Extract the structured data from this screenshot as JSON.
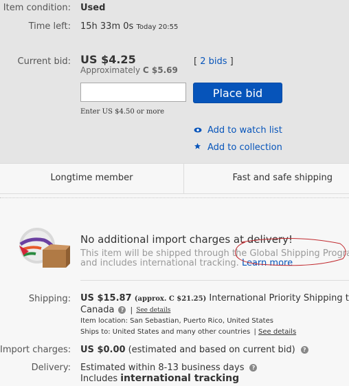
{
  "item": {
    "condition_label": "Item condition:",
    "condition_value": "Used",
    "time_left_label": "Time left:",
    "time_left_value": "15h 33m 0s",
    "time_left_end": "Today 20:55"
  },
  "bid": {
    "label": "Current bid:",
    "amount": "US $4.25",
    "approx_prefix": "Approximately",
    "approx_value": "C $5.69",
    "bids_open": "[",
    "bids_link": "2 bids",
    "bids_close": "]",
    "input_value": "",
    "input_placeholder": "",
    "button_label": "Place bid",
    "hint": "Enter US $4.50 or more"
  },
  "actions": {
    "watch_label": "Add to watch list",
    "collection_label": "Add to collection"
  },
  "badges": {
    "left": "Longtime member",
    "right": "Fast and safe shipping"
  },
  "import": {
    "heading": "No additional import charges at delivery!",
    "line1": "This item will be shipped through the Global Shipping Program",
    "line2_prefix": "and includes international tracking.",
    "learn_more": "Learn more"
  },
  "shipping": {
    "label": "Shipping:",
    "price": "US $15.87",
    "approx": "(approx. C $21.25)",
    "service": "International Priority Shipping to",
    "destination": "Canada",
    "separator": "|",
    "see_details": "See details",
    "location_text": "Item location:  San Sebastian, Puerto Rico, United States",
    "ships_to_text": "Ships to:  United States and many other countries",
    "ships_sep": "|",
    "ships_see_details": "See details"
  },
  "import_charges": {
    "label": "Import charges:",
    "value": "US $0.00",
    "note": "(estimated and based on current bid)"
  },
  "delivery": {
    "label": "Delivery:",
    "estimate": "Estimated within 8-13 business days",
    "includes_prefix": "Includes",
    "includes_bold": "international tracking"
  },
  "colors": {
    "accent": "#0654ba",
    "annotation": "#c0282d"
  },
  "icons": {
    "watch": "eye-icon",
    "collection": "star-icon",
    "help": "question-icon",
    "gsp": "globe-package-icon"
  }
}
